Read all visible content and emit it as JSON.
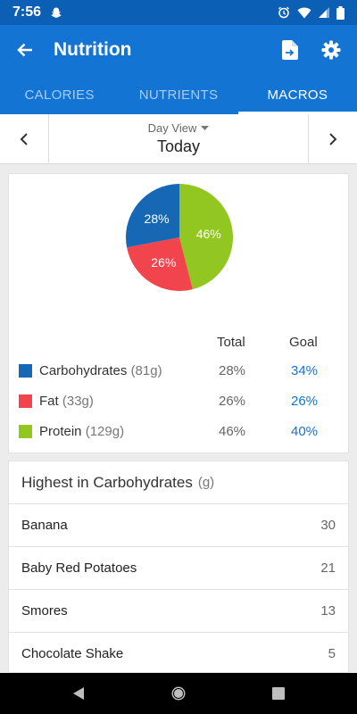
{
  "status_bar": {
    "time": "7:56",
    "icons": [
      "snapchat-icon",
      "alarm-icon",
      "wifi-icon",
      "signal-icon",
      "battery-icon"
    ]
  },
  "app_bar": {
    "title": "Nutrition",
    "icons": [
      "back-arrow-icon",
      "export-file-icon",
      "gear-icon"
    ],
    "color": "#1474d3"
  },
  "tabs": [
    {
      "label": "CALORIES",
      "active": false
    },
    {
      "label": "NUTRIENTS",
      "active": false
    },
    {
      "label": "MACROS",
      "active": true
    }
  ],
  "date_nav": {
    "view_label": "Day View",
    "date_label": "Today"
  },
  "chart_data": {
    "type": "pie",
    "slices": [
      {
        "label": "Carbohydrates",
        "value": 28,
        "color": "#1768b4"
      },
      {
        "label": "Fat",
        "value": 26,
        "color": "#f2444c"
      },
      {
        "label": "Protein",
        "value": 46,
        "color": "#92c721"
      }
    ],
    "slice_labels": [
      "28%",
      "26%",
      "46%"
    ]
  },
  "macro_table": {
    "headers": {
      "total": "Total",
      "goal": "Goal"
    },
    "rows": [
      {
        "name": "Carbohydrates",
        "grams": "(81g)",
        "total": "28%",
        "goal": "34%",
        "color": "#1768b4"
      },
      {
        "name": "Fat",
        "grams": "(33g)",
        "total": "26%",
        "goal": "26%",
        "color": "#f2444c"
      },
      {
        "name": "Protein",
        "grams": "(129g)",
        "total": "46%",
        "goal": "40%",
        "color": "#92c721"
      }
    ]
  },
  "highest_list": {
    "title": "Highest in Carbohydrates",
    "unit": "(g)",
    "items": [
      {
        "name": "Banana",
        "value": "30"
      },
      {
        "name": "Baby Red Potatoes",
        "value": "21"
      },
      {
        "name": "Smores",
        "value": "13"
      },
      {
        "name": "Chocolate Shake",
        "value": "5"
      }
    ]
  },
  "nav_bar": {
    "icons": [
      "back-triangle-icon",
      "home-circle-icon",
      "recents-square-icon"
    ]
  }
}
